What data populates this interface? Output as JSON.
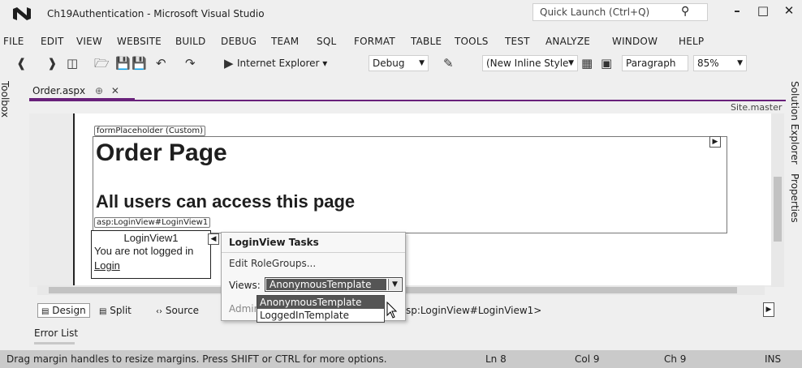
{
  "window": {
    "title": "Ch19Authentication - Microsoft Visual Studio",
    "quick_launch_placeholder": "Quick Launch (Ctrl+Q)",
    "minimize": "–",
    "maximize": "□",
    "close": "✕"
  },
  "menu": [
    "FILE",
    "EDIT",
    "VIEW",
    "WEBSITE",
    "BUILD",
    "DEBUG",
    "TEAM",
    "SQL",
    "FORMAT",
    "TABLE",
    "TOOLS",
    "TEST",
    "ANALYZE",
    "WINDOW",
    "HELP"
  ],
  "toolbar": {
    "browser": "Internet Explorer ▾",
    "config": "Debug",
    "style": "(New Inline Style",
    "block": "Paragraph",
    "zoom": "85%"
  },
  "side": {
    "left_panel": "Toolbox",
    "right_panel_1": "Solution Explorer",
    "right_panel_2": "Properties"
  },
  "document": {
    "tab_label": "Order.aspx",
    "tab_pin": "⊕",
    "tab_close": "✕",
    "master_label": "Site.master",
    "placeholder_label": "formPlaceholder (Custom)",
    "heading1": "Order Page",
    "heading2": "All users can access this page",
    "loginview_tag": "asp:LoginView#LoginView1",
    "loginview_title": "LoginView1",
    "loginview_text": "You are not logged in",
    "loginview_link": "Login"
  },
  "tasks_panel": {
    "title": "LoginView Tasks",
    "edit_rolegroups": "Edit RoleGroups...",
    "views_label": "Views:",
    "views_selected": "AnonymousTemplate",
    "admin_text": "Admir",
    "options": [
      "AnonymousTemplate",
      "LoggedInTemplate"
    ]
  },
  "view_bar": {
    "design": "Design",
    "split": "Split",
    "source": "Source",
    "breadcrumb": "sp:LoginView#LoginView1>"
  },
  "error_list": "Error List",
  "status": {
    "message": "Drag margin handles to resize margins. Press SHIFT or CTRL for more options.",
    "line": "Ln 8",
    "col": "Col 9",
    "ch": "Ch 9",
    "mode": "INS"
  },
  "colors": {
    "accent": "#68217a",
    "status_bar": "#cacaca",
    "selection": "#555555"
  }
}
